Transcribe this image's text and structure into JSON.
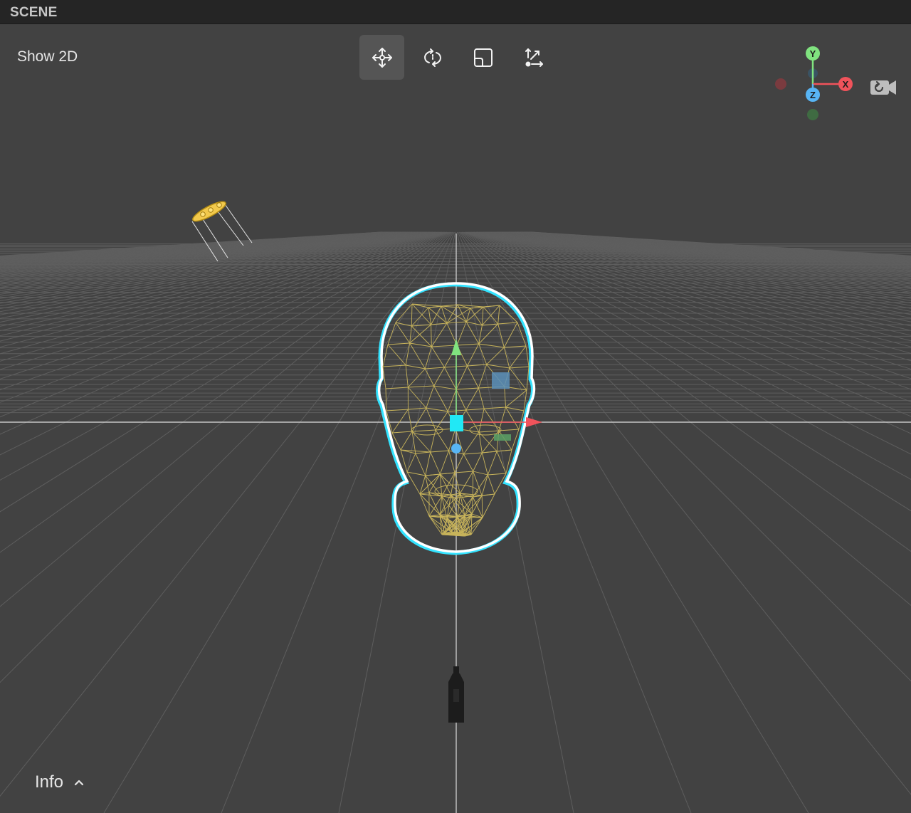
{
  "panel": {
    "title": "SCENE"
  },
  "viewport": {
    "show2d_label": "Show 2D",
    "toolbar": [
      {
        "id": "move",
        "icon": "move-icon",
        "active": true
      },
      {
        "id": "rotate",
        "icon": "rotate-icon",
        "active": false
      },
      {
        "id": "scale",
        "icon": "scale-icon",
        "active": false
      },
      {
        "id": "world-local",
        "icon": "transform-space-icon",
        "active": false
      }
    ],
    "gizmo": {
      "x_label": "X",
      "y_label": "Y",
      "z_label": "Z",
      "x_color": "#f0535b",
      "y_color": "#80e37f",
      "z_color": "#58b5f5"
    },
    "camera_icon": "camera-reset-icon",
    "info": {
      "label": "Info",
      "icon": "chevron-up-icon"
    }
  },
  "colors": {
    "background": "#424242",
    "header": "#252525",
    "grid": "#5e5e5e",
    "selection_outline": "#ffffff",
    "selection_glow": "#33e3ff",
    "mesh": "#c8b45b",
    "light": "#f2c94c"
  }
}
